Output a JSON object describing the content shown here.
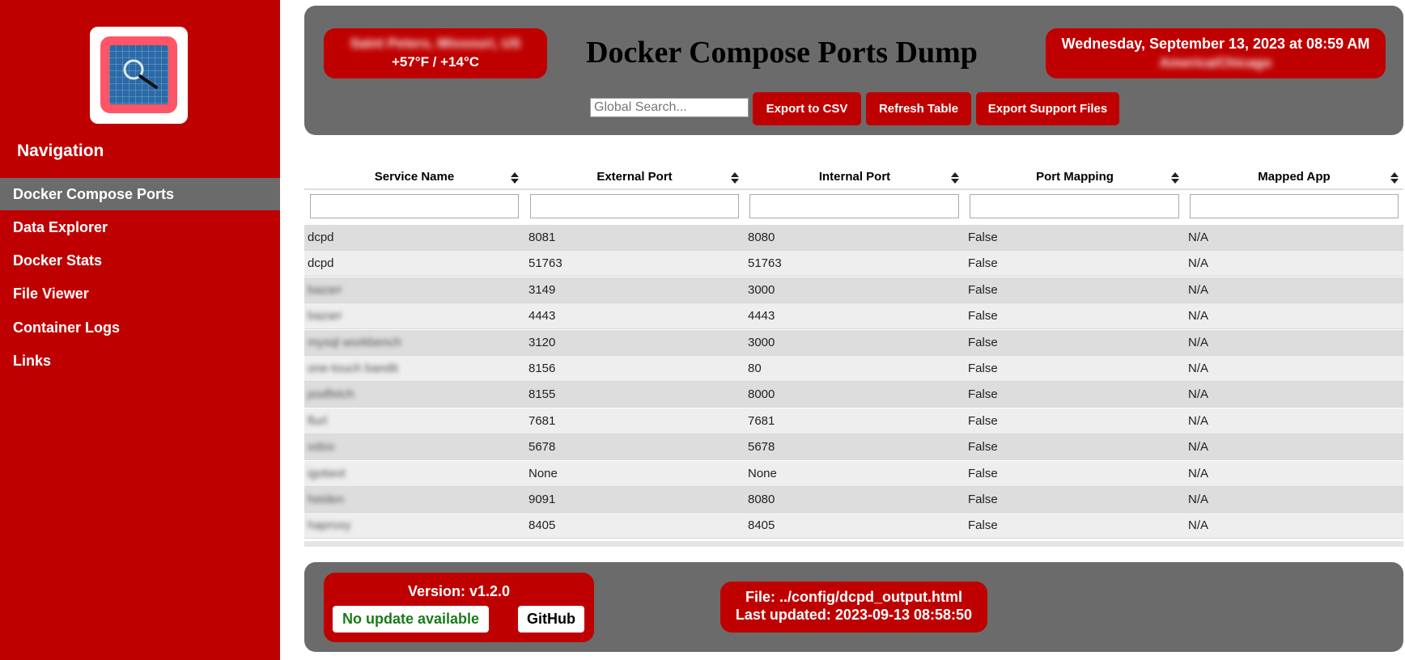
{
  "sidebar": {
    "nav_title": "Navigation",
    "items": [
      {
        "label": "Docker Compose Ports",
        "active": true
      },
      {
        "label": "Data Explorer"
      },
      {
        "label": "Docker Stats"
      },
      {
        "label": "File Viewer"
      },
      {
        "label": "Container Logs"
      },
      {
        "label": "Links"
      }
    ]
  },
  "header": {
    "location": "Saint Peters, Missouri, US",
    "temperature": "+57°F / +14°C",
    "title": "Docker Compose Ports Dump",
    "datetime": "Wednesday, September 13, 2023 at 08:59 AM",
    "timezone": "America/Chicago",
    "search_placeholder": "Global Search...",
    "buttons": {
      "export_csv": "Export to CSV",
      "refresh": "Refresh Table",
      "export_support": "Export Support Files"
    }
  },
  "table": {
    "columns": [
      "Service Name",
      "External Port",
      "Internal Port",
      "Port Mapping",
      "Mapped App"
    ],
    "rows": [
      [
        "dcpd",
        "8081",
        "8080",
        "False",
        "N/A"
      ],
      [
        "dcpd",
        "51763",
        "51763",
        "False",
        "N/A"
      ],
      [
        "bazarr",
        "3149",
        "3000",
        "False",
        "N/A"
      ],
      [
        "bazarr",
        "4443",
        "4443",
        "False",
        "N/A"
      ],
      [
        "mysql workbench",
        "3120",
        "3000",
        "False",
        "N/A"
      ],
      [
        "one-touch bandit",
        "8156",
        "80",
        "False",
        "N/A"
      ],
      [
        "podfetch",
        "8155",
        "8000",
        "False",
        "N/A"
      ],
      [
        "flurl",
        "7681",
        "7681",
        "False",
        "N/A"
      ],
      [
        "odoo",
        "5678",
        "5678",
        "False",
        "N/A"
      ],
      [
        "igotwvt",
        "None",
        "None",
        "False",
        "N/A"
      ],
      [
        "heiden",
        "9091",
        "8080",
        "False",
        "N/A"
      ],
      [
        "haproxy",
        "8405",
        "8405",
        "False",
        "N/A"
      ]
    ]
  },
  "footer": {
    "version": "Version: v1.2.0",
    "update_status": "No update available",
    "github": "GitHub",
    "file": "File: ../config/dcpd_output.html",
    "last_updated": "Last updated: 2023-09-13 08:58:50"
  },
  "colors": {
    "brand_red": "#bf0000",
    "panel_gray": "#6b6b6b",
    "ok_green": "#1a7a1a"
  }
}
